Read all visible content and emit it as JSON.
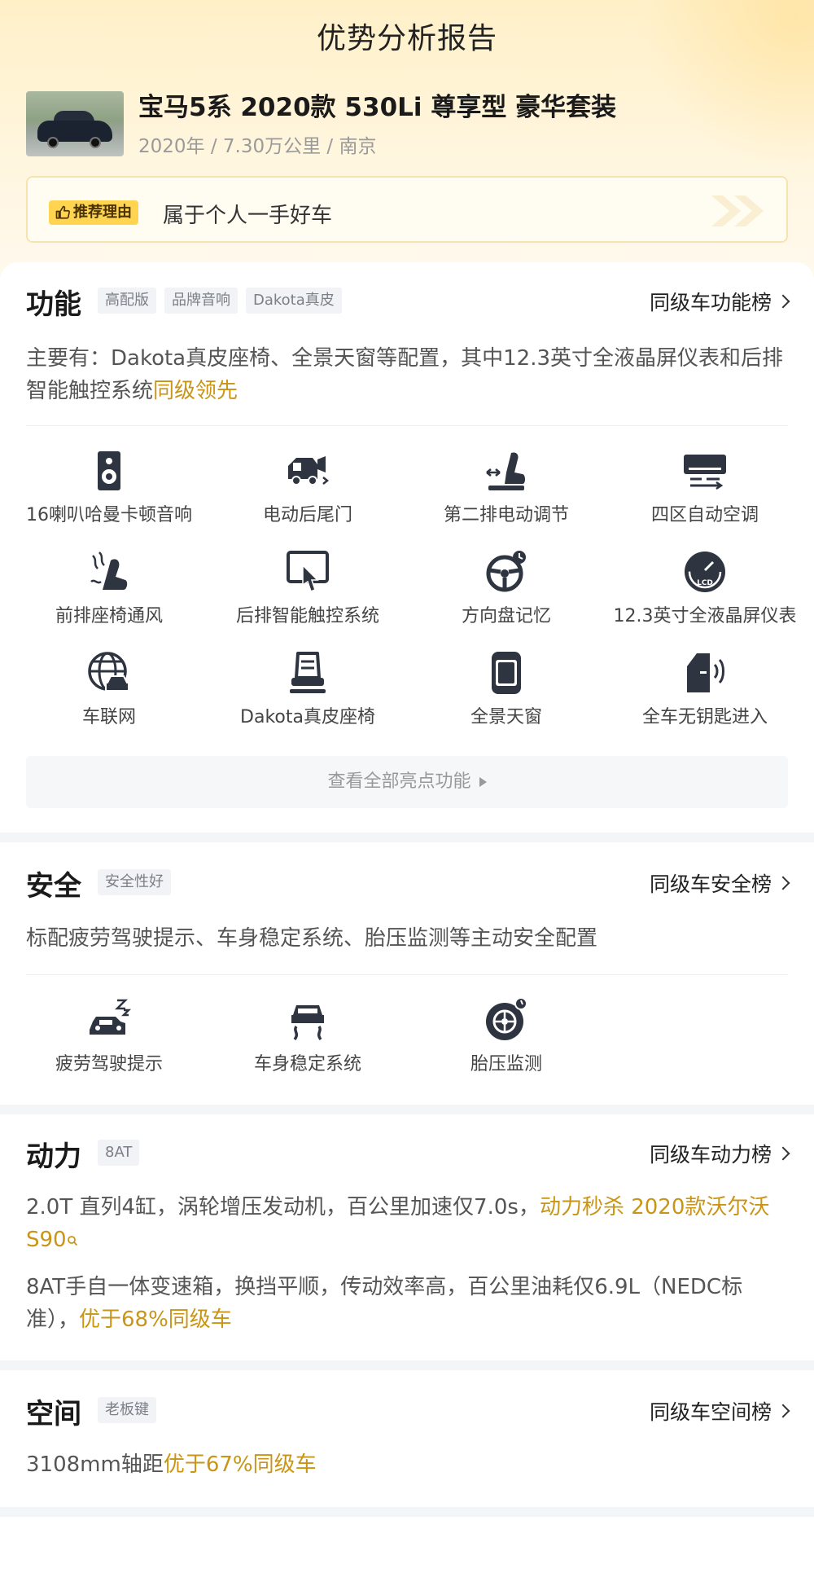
{
  "header": {
    "title": "优势分析报告"
  },
  "car": {
    "name": "宝马5系 2020款 530Li 尊享型 豪华套装",
    "meta": "2020年 / 7.30万公里 / 南京"
  },
  "reason": {
    "badge_label": "推荐理由",
    "text": "属于个人一手好车"
  },
  "function_section": {
    "title": "功能",
    "tags": [
      "高配版",
      "品牌音响",
      "Dakota真皮"
    ],
    "rank_link": "同级车功能榜",
    "desc_main": "主要有：Dakota真皮座椅、全景天窗等配置，其中12.3英寸全液晶屏仪表和后排智能触控系统",
    "desc_highlight": "同级领先",
    "features": [
      {
        "label": "16喇叭哈曼卡顿音响",
        "icon": "speaker-icon"
      },
      {
        "label": "电动后尾门",
        "icon": "power-tailgate-icon"
      },
      {
        "label": "第二排电动调节",
        "icon": "seat-adjust-icon"
      },
      {
        "label": "四区自动空调",
        "icon": "air-conditioner-icon"
      },
      {
        "label": "前排座椅通风",
        "icon": "seat-ventilation-icon"
      },
      {
        "label": "后排智能触控系统",
        "icon": "touch-screen-icon"
      },
      {
        "label": "方向盘记忆",
        "icon": "steering-wheel-memory-icon"
      },
      {
        "label": "12.3英寸全液晶屏仪表",
        "icon": "lcd-gauge-icon"
      },
      {
        "label": "车联网",
        "icon": "connected-car-icon"
      },
      {
        "label": "Dakota真皮座椅",
        "icon": "leather-seat-icon"
      },
      {
        "label": "全景天窗",
        "icon": "panoramic-sunroof-icon"
      },
      {
        "label": "全车无钥匙进入",
        "icon": "keyless-entry-icon"
      }
    ],
    "more_label": "查看全部亮点功能"
  },
  "safety_section": {
    "title": "安全",
    "tags": [
      "安全性好"
    ],
    "rank_link": "同级车安全榜",
    "desc": "标配疲劳驾驶提示、车身稳定系统、胎压监测等主动安全配置",
    "features": [
      {
        "label": "疲劳驾驶提示",
        "icon": "fatigue-warning-icon"
      },
      {
        "label": "车身稳定系统",
        "icon": "stability-control-icon"
      },
      {
        "label": "胎压监测",
        "icon": "tire-pressure-icon"
      }
    ]
  },
  "power_section": {
    "title": "动力",
    "tags": [
      "8AT"
    ],
    "rank_link": "同级车动力榜",
    "desc1_main": "2.0T 直列4缸，涡轮增压发动机，百公里加速仅7.0s，",
    "desc1_highlight": "动力秒杀 2020款沃尔沃S90",
    "desc2_main": "8AT手自一体变速箱，换挡平顺，传动效率高，百公里油耗仅6.9L（NEDC标准），",
    "desc2_highlight": "优于68%同级车"
  },
  "space_section": {
    "title": "空间",
    "tags": [
      "老板键"
    ],
    "rank_link": "同级车空间榜",
    "desc_main": "3108mm轴距",
    "desc_highlight": "优于67%同级车"
  },
  "colors": {
    "accent": "#c99516",
    "badge": "#ffd451",
    "icon": "#2e3440"
  }
}
